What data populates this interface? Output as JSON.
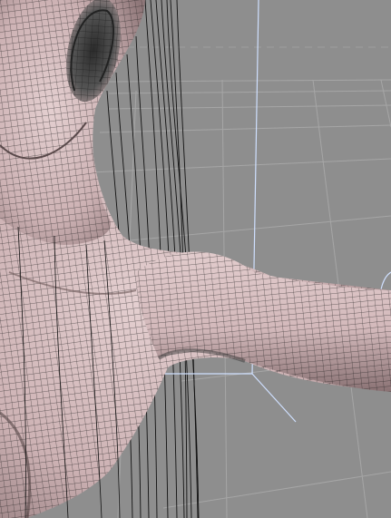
{
  "viewport": {
    "view": "perspective",
    "shading": "wireframe-on-shaded",
    "colors": {
      "background": "#8e8e8e",
      "grid_line": "#a6a6a6",
      "grid_line_dark": "#7a7a7a",
      "horizon_dashed": "#9f9f9f",
      "skin": "#d9c0c2",
      "skin_shadow": "#8f7779",
      "wire": "#1a1a1a",
      "manipulator": "#cfe0ff",
      "hair": "#111111"
    },
    "icons": [
      "transform-manipulator-icon",
      "rotate-handle-icon"
    ]
  }
}
